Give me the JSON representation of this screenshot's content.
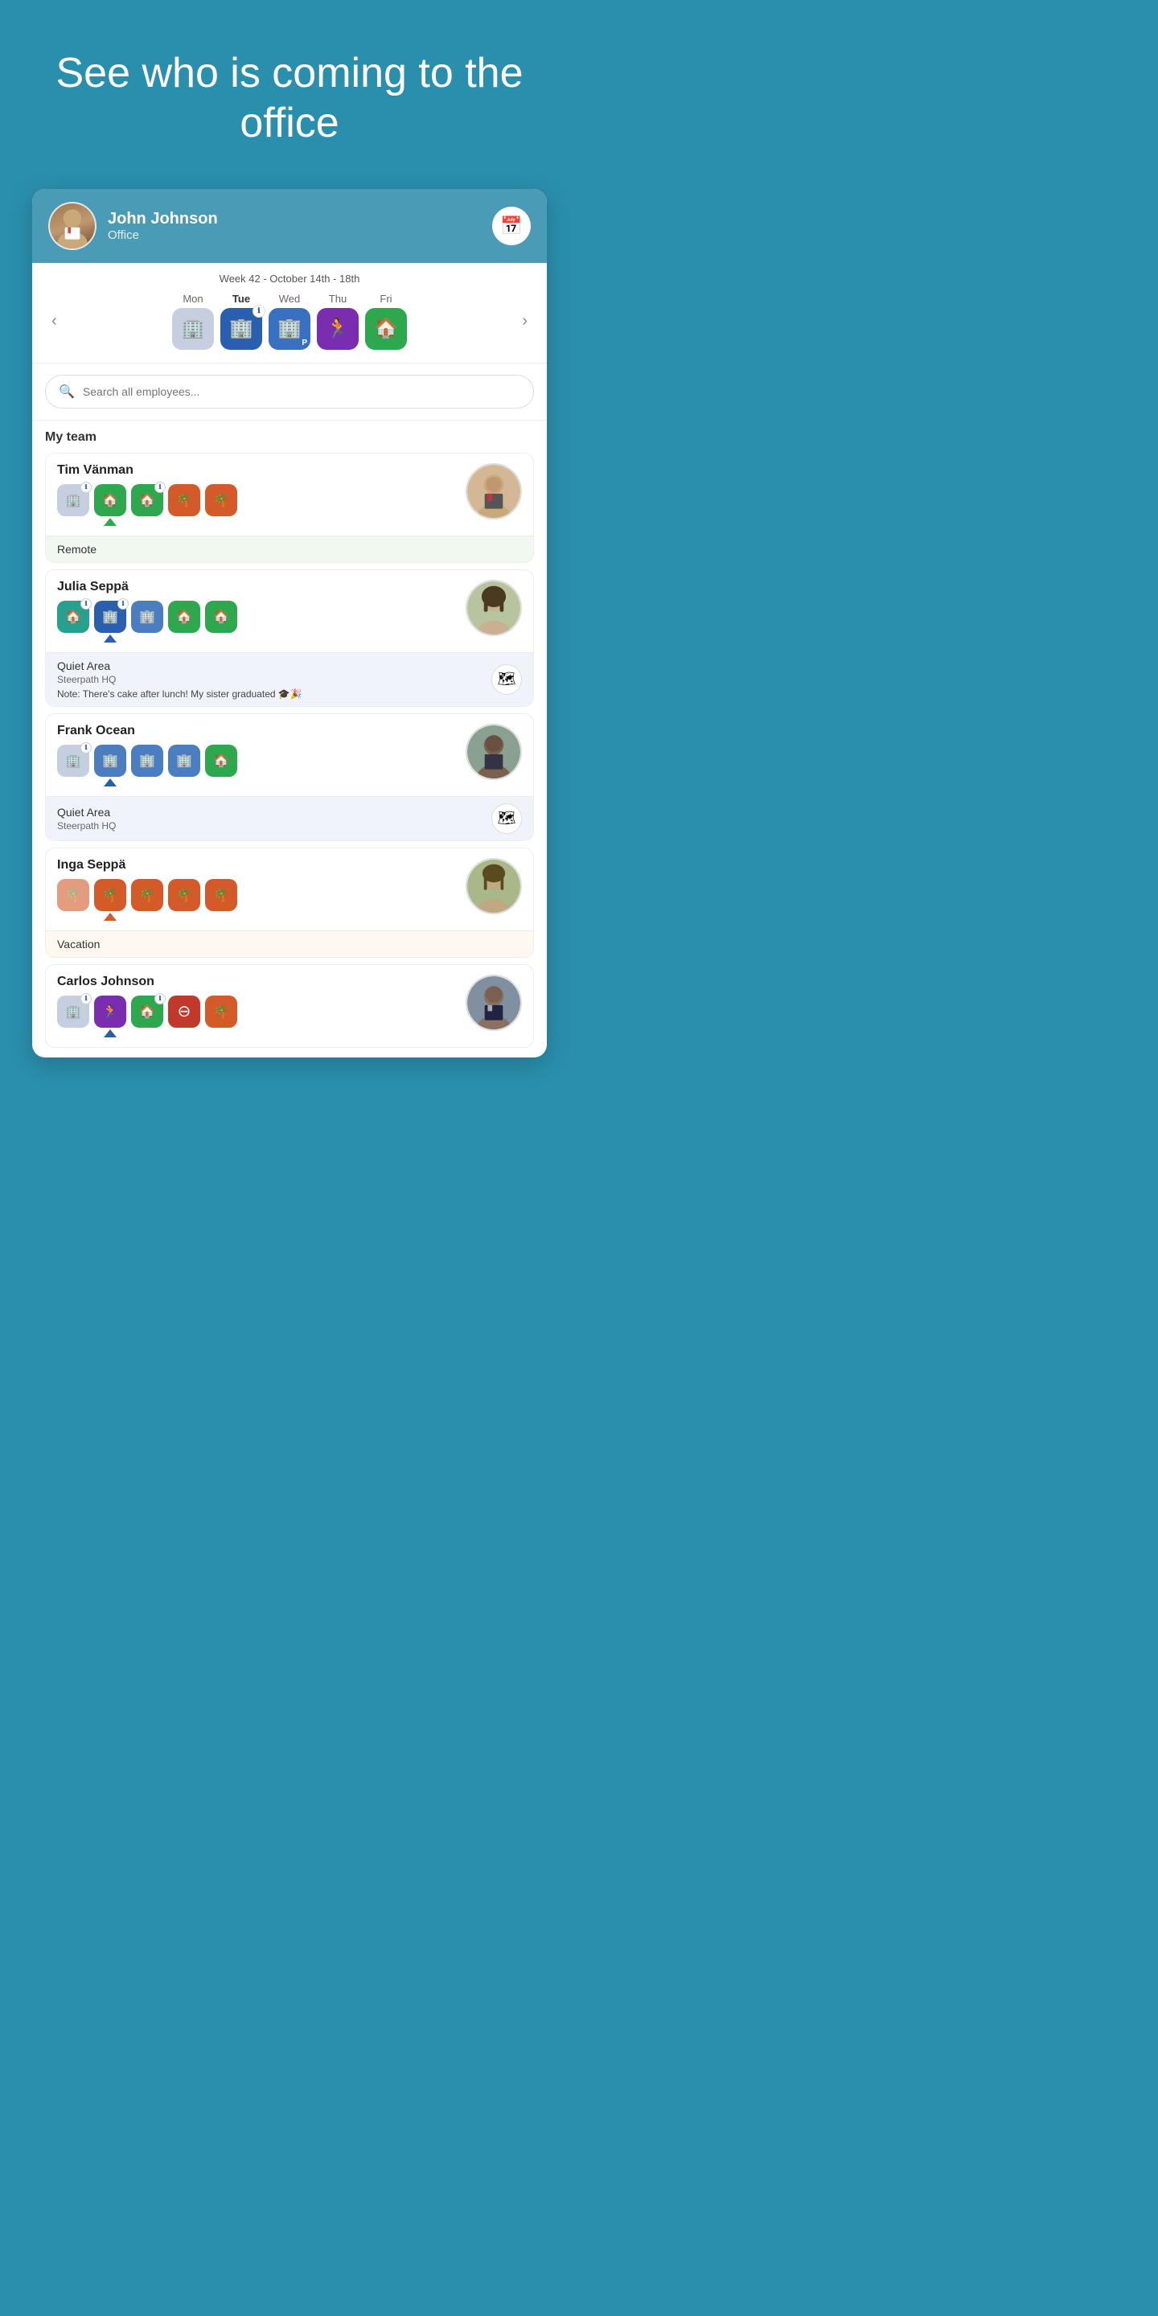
{
  "hero": {
    "title": "See who is coming to the office"
  },
  "header": {
    "name": "John Johnson",
    "subtitle": "Office",
    "calendar_btn_icon": "📅"
  },
  "week": {
    "label": "Week 42 - October 14th - 18th",
    "days": [
      {
        "short": "Mon",
        "bold": false,
        "icon_type": "office-light",
        "icon": "🏢",
        "info": false
      },
      {
        "short": "Tue",
        "bold": true,
        "icon_type": "office-blue",
        "icon": "🏢",
        "info": true
      },
      {
        "short": "Wed",
        "bold": false,
        "icon_type": "office-blue-p",
        "icon": "🏢",
        "info": false,
        "extra": "P"
      },
      {
        "short": "Thu",
        "bold": false,
        "icon_type": "purple",
        "icon": "🏃",
        "info": false
      },
      {
        "short": "Fri",
        "bold": false,
        "icon_type": "green-home",
        "icon": "🏠",
        "info": false
      }
    ]
  },
  "search": {
    "placeholder": "Search all employees..."
  },
  "team_label": "My team",
  "employees": [
    {
      "name": "Tim Vänman",
      "avatar_type": "tim",
      "selected_day": 1,
      "selected_color": "green",
      "status": "Remote",
      "status_sub": "",
      "status_note": "",
      "status_type": "remote",
      "schedule": [
        {
          "type": "bg-office-light",
          "icon": "🏢",
          "info": true
        },
        {
          "type": "bg-green",
          "icon": "🏠",
          "info": false
        },
        {
          "type": "bg-green",
          "icon": "🏠",
          "info": true
        },
        {
          "type": "bg-orange",
          "icon": "🌴",
          "info": false
        },
        {
          "type": "bg-orange",
          "icon": "🌴",
          "info": false
        }
      ]
    },
    {
      "name": "Julia Seppä",
      "avatar_type": "julia",
      "selected_day": 1,
      "selected_color": "blue",
      "status": "Quiet Area",
      "status_sub": "Steerpath HQ",
      "status_note": "Note: There's cake after lunch!  My sister graduated 🎓🎉",
      "status_type": "quiet",
      "schedule": [
        {
          "type": "bg-teal",
          "icon": "🏠",
          "info": true
        },
        {
          "type": "bg-office-blue",
          "icon": "🏢",
          "info": true
        },
        {
          "type": "bg-office-med",
          "icon": "🏢",
          "info": false
        },
        {
          "type": "bg-green",
          "icon": "🏠",
          "info": false
        },
        {
          "type": "bg-green",
          "icon": "🏠",
          "info": false
        }
      ]
    },
    {
      "name": "Frank Ocean",
      "avatar_type": "frank",
      "selected_day": 1,
      "selected_color": "blue",
      "status": "Quiet Area",
      "status_sub": "Steerpath HQ",
      "status_note": "",
      "status_type": "quiet",
      "schedule": [
        {
          "type": "bg-office-light",
          "icon": "🏢",
          "info": true
        },
        {
          "type": "bg-office-med",
          "icon": "🏢",
          "info": false
        },
        {
          "type": "bg-office-med",
          "icon": "🏢",
          "info": false
        },
        {
          "type": "bg-office-med",
          "icon": "🏢",
          "info": false
        },
        {
          "type": "bg-green",
          "icon": "🏠",
          "info": false
        }
      ]
    },
    {
      "name": "Inga Seppä",
      "avatar_type": "inga",
      "selected_day": 1,
      "selected_color": "orange",
      "status": "Vacation",
      "status_sub": "",
      "status_note": "",
      "status_type": "vacation",
      "schedule": [
        {
          "type": "bg-orange",
          "icon": "🌴",
          "info": false
        },
        {
          "type": "bg-orange",
          "icon": "🌴",
          "info": false
        },
        {
          "type": "bg-orange",
          "icon": "🌴",
          "info": false
        },
        {
          "type": "bg-orange",
          "icon": "🌴",
          "info": false
        },
        {
          "type": "bg-orange",
          "icon": "🌴",
          "info": false
        }
      ]
    },
    {
      "name": "Carlos Johnson",
      "avatar_type": "carlos",
      "selected_day": 1,
      "selected_color": "blue",
      "status": "",
      "status_sub": "",
      "status_note": "",
      "status_type": "",
      "schedule": [
        {
          "type": "bg-office-light",
          "icon": "🏢",
          "info": true
        },
        {
          "type": "bg-purple",
          "icon": "🏃",
          "info": false
        },
        {
          "type": "bg-green",
          "icon": "🏠",
          "info": true
        },
        {
          "type": "bg-red",
          "icon": "⊖",
          "info": false
        },
        {
          "type": "bg-orange",
          "icon": "🌴",
          "info": false
        }
      ]
    }
  ]
}
